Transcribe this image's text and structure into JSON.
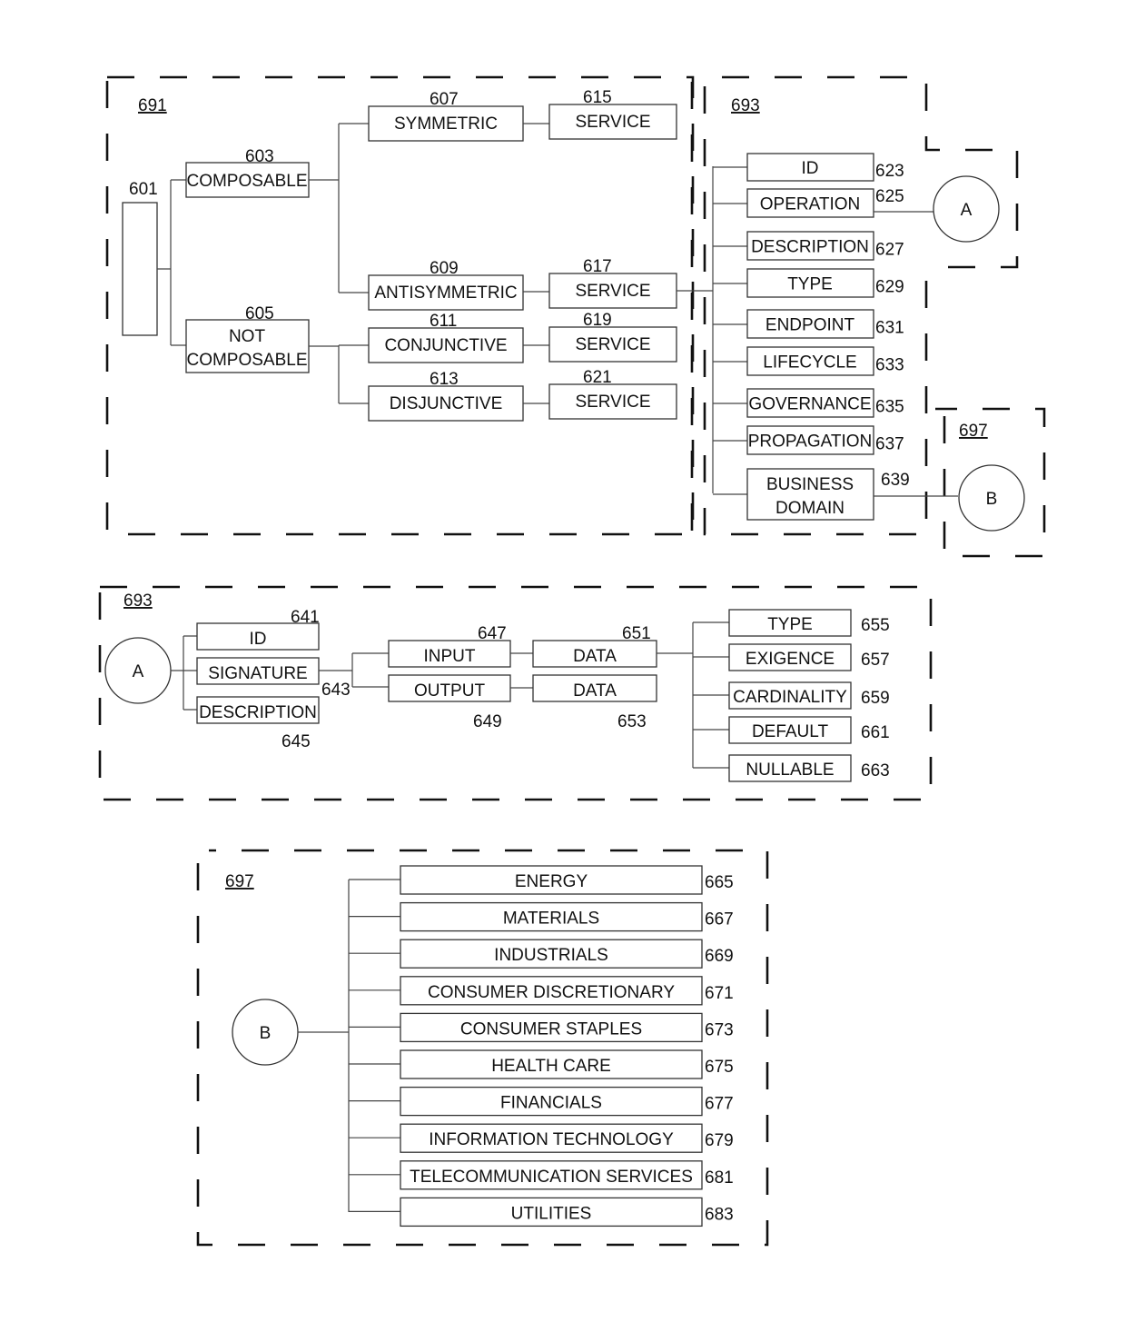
{
  "figure": {
    "region_691": {
      "ref": "691",
      "root": {
        "ref": "601",
        "label": ""
      },
      "composable": {
        "ref": "603",
        "label": "COMPOSABLE"
      },
      "not_composable": {
        "ref": "605",
        "label_line1": "NOT",
        "label_line2": "COMPOSABLE"
      },
      "types": [
        {
          "ref": "607",
          "label": "SYMMETRIC",
          "service_ref": "615",
          "service_label": "SERVICE"
        },
        {
          "ref": "609",
          "label": "ANTISYMMETRIC",
          "service_ref": "617",
          "service_label": "SERVICE"
        },
        {
          "ref": "611",
          "label": "CONJUNCTIVE",
          "service_ref": "619",
          "service_label": "SERVICE"
        },
        {
          "ref": "613",
          "label": "DISJUNCTIVE",
          "service_ref": "621",
          "service_label": "SERVICE"
        }
      ]
    },
    "region_693_top": {
      "ref": "693",
      "attributes": [
        {
          "ref": "623",
          "label": "ID"
        },
        {
          "ref": "625",
          "label": "OPERATION"
        },
        {
          "ref": "627",
          "label": "DESCRIPTION"
        },
        {
          "ref": "629",
          "label": "TYPE"
        },
        {
          "ref": "631",
          "label": "ENDPOINT"
        },
        {
          "ref": "633",
          "label": "LIFECYCLE"
        },
        {
          "ref": "635",
          "label": "GOVERNANCE"
        },
        {
          "ref": "637",
          "label": "PROPAGATION"
        },
        {
          "ref": "639",
          "label_line1": "BUSINESS",
          "label_line2": "DOMAIN"
        }
      ],
      "connector_a": "A"
    },
    "region_697_top": {
      "ref": "697",
      "connector_b": "B"
    },
    "region_693_detail": {
      "ref": "693",
      "connector_a": "A",
      "operation_parts": [
        {
          "ref": "641",
          "label": "ID"
        },
        {
          "ref": "643",
          "label": "SIGNATURE"
        },
        {
          "ref": "645",
          "label": "DESCRIPTION"
        }
      ],
      "io": [
        {
          "ref": "647",
          "label": "INPUT",
          "data_ref": "651",
          "data_label": "DATA"
        },
        {
          "ref": "649",
          "label": "OUTPUT",
          "data_ref": "653",
          "data_label": "DATA"
        }
      ],
      "data_attributes": [
        {
          "ref": "655",
          "label": "TYPE"
        },
        {
          "ref": "657",
          "label": "EXIGENCE"
        },
        {
          "ref": "659",
          "label": "CARDINALITY"
        },
        {
          "ref": "661",
          "label": "DEFAULT"
        },
        {
          "ref": "663",
          "label": "NULLABLE"
        }
      ]
    },
    "region_697_detail": {
      "ref": "697",
      "connector_b": "B",
      "domains": [
        {
          "ref": "665",
          "label": "ENERGY"
        },
        {
          "ref": "667",
          "label": "MATERIALS"
        },
        {
          "ref": "669",
          "label": "INDUSTRIALS"
        },
        {
          "ref": "671",
          "label": "CONSUMER DISCRETIONARY"
        },
        {
          "ref": "673",
          "label": "CONSUMER STAPLES"
        },
        {
          "ref": "675",
          "label": "HEALTH CARE"
        },
        {
          "ref": "677",
          "label": "FINANCIALS"
        },
        {
          "ref": "679",
          "label": "INFORMATION TECHNOLOGY"
        },
        {
          "ref": "681",
          "label": "TELECOMMUNICATION SERVICES"
        },
        {
          "ref": "683",
          "label": "UTILITIES"
        }
      ]
    }
  }
}
